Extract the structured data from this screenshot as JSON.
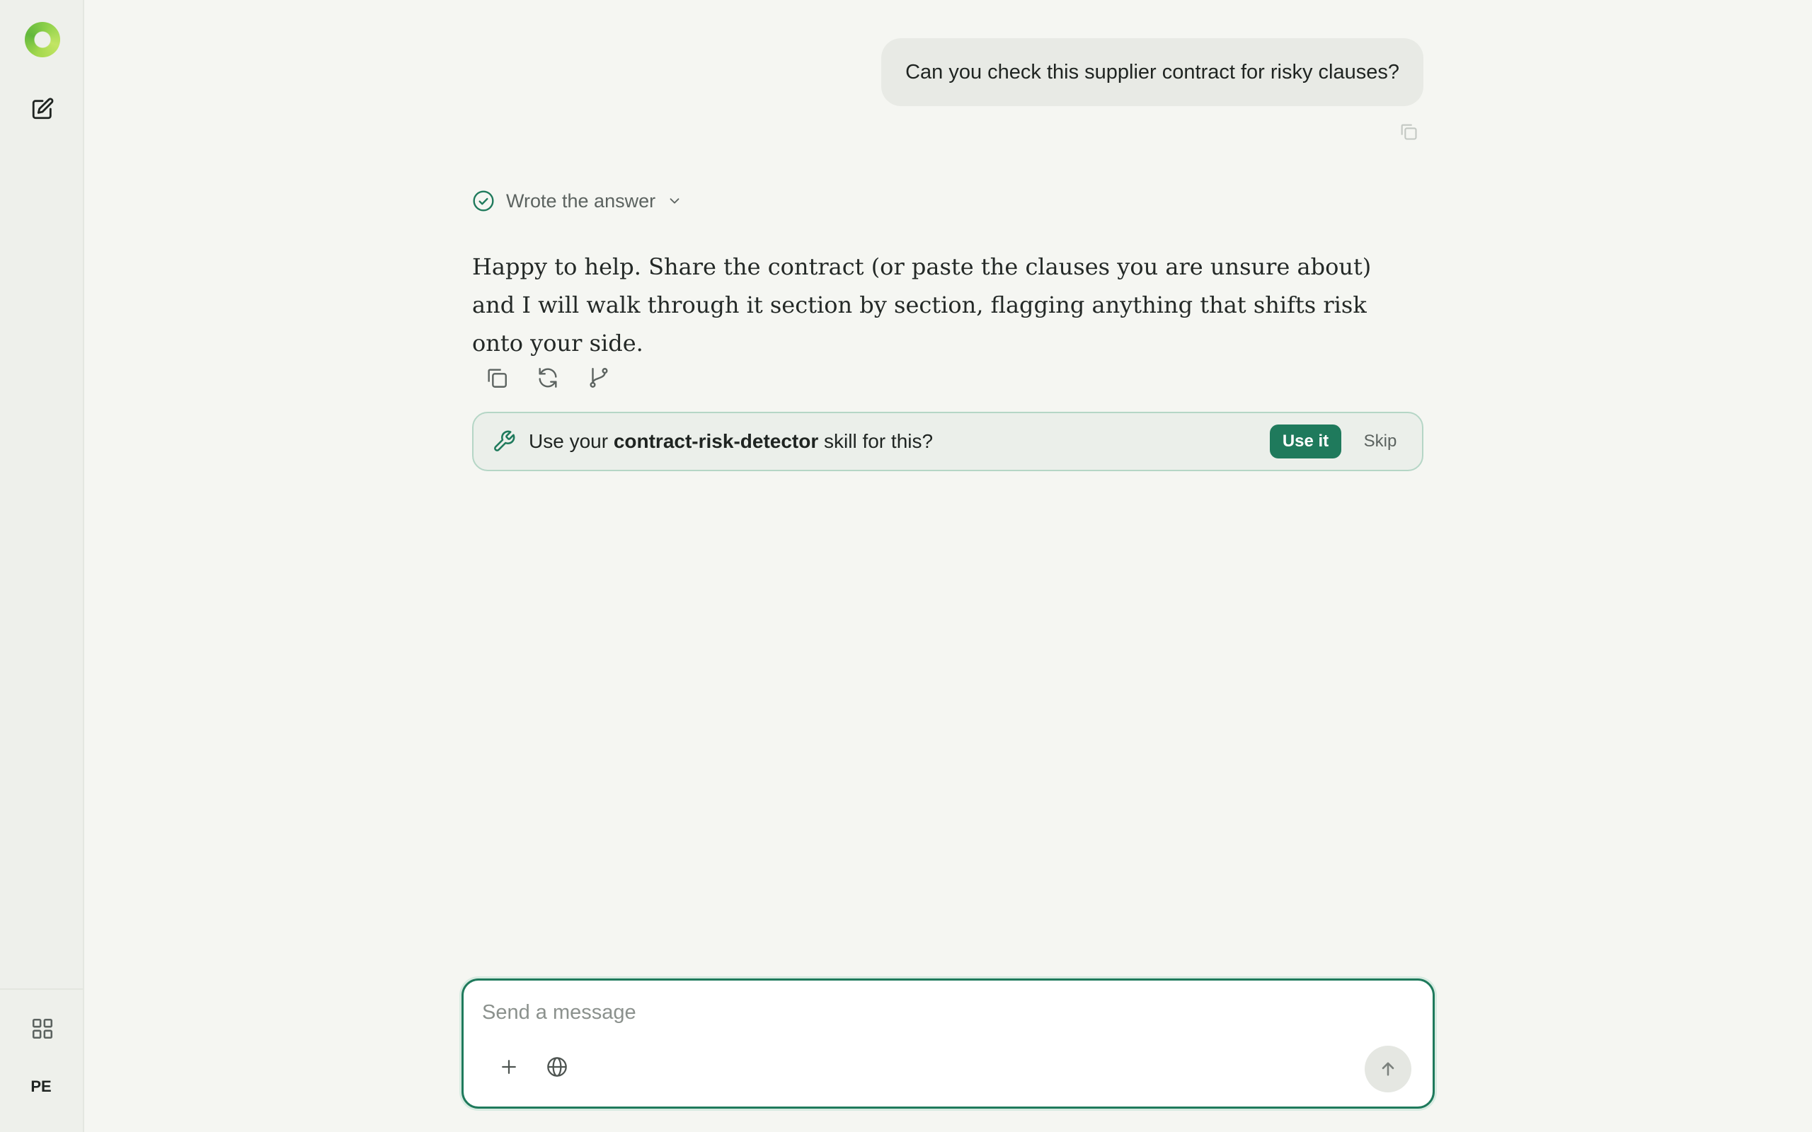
{
  "sidebar": {
    "avatar_initials": "PE",
    "icons": [
      "app-logo",
      "new-chat-icon",
      "apps-grid-icon"
    ]
  },
  "conversation": {
    "user_message": "Can you check this supplier contract for risky clauses?",
    "assistant": {
      "status": "Wrote the answer",
      "answer": "Happy to help. Share the contract (or paste the clauses you are unsure about) and I will walk through it section by section, flagging anything that shifts risk onto your side.",
      "action_icons": [
        "copy-icon",
        "regenerate-icon",
        "branch-icon"
      ]
    }
  },
  "skill_suggestion": {
    "prefix": "Use your ",
    "skill_name": "contract-risk-detector",
    "suffix": " skill for this?",
    "use_label": "Use it",
    "skip_label": "Skip"
  },
  "composer": {
    "placeholder": "Send a message",
    "value": "",
    "tool_icons": [
      "plus-icon",
      "globe-icon"
    ],
    "send_icon": "arrow-up-icon"
  },
  "colors": {
    "background": "#f5f6f2",
    "sidebar": "#eef0eb",
    "accent": "#1f7a5c",
    "user_bubble": "#e8eae5",
    "skill_border": "#b5d6c6"
  }
}
